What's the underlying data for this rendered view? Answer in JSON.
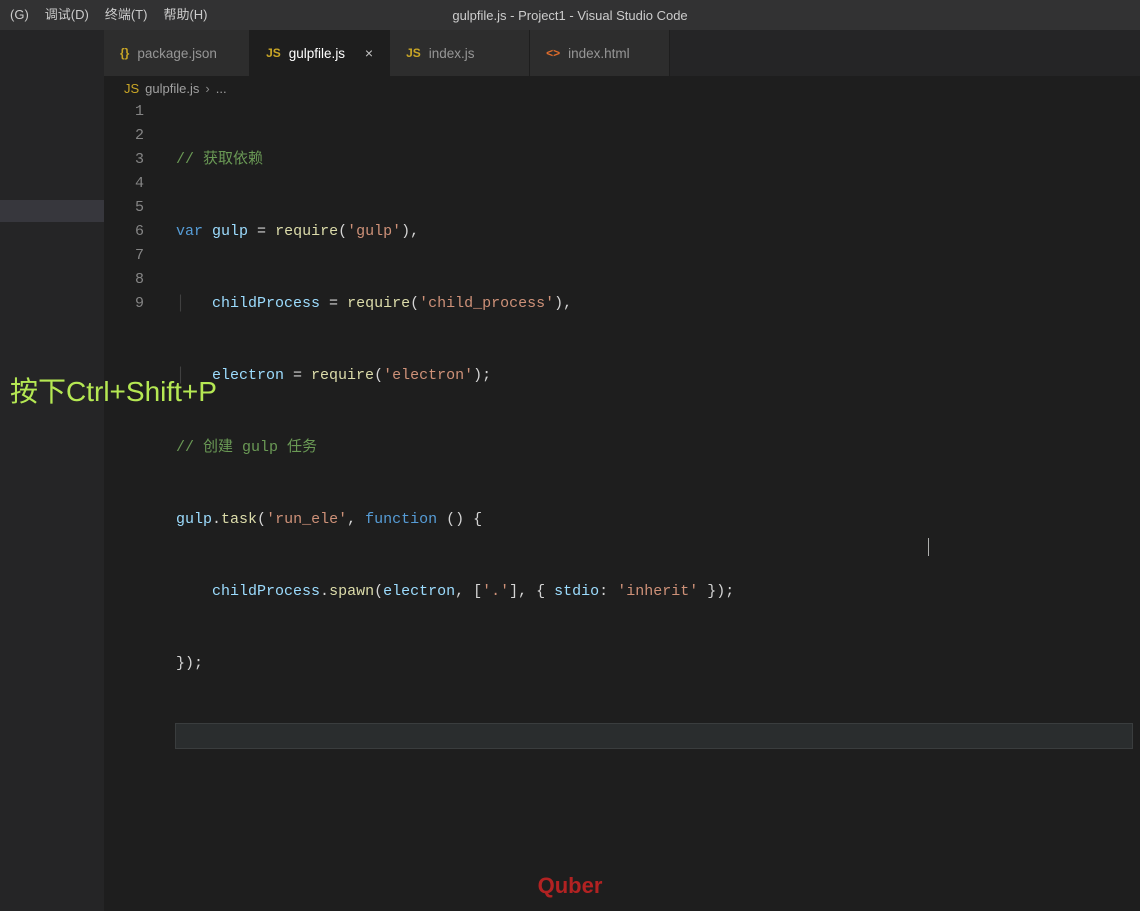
{
  "titlebar": {
    "menus": [
      "(G)",
      "调试(D)",
      "终端(T)",
      "帮助(H)"
    ],
    "title": "gulpfile.js - Project1 - Visual Studio Code"
  },
  "tabs": [
    {
      "icon": "{}",
      "iconClass": "icon-json",
      "label": "package.json",
      "active": false
    },
    {
      "icon": "JS",
      "iconClass": "icon-js",
      "label": "gulpfile.js",
      "active": true
    },
    {
      "icon": "JS",
      "iconClass": "icon-js",
      "label": "index.js",
      "active": false
    },
    {
      "icon": "<>",
      "iconClass": "icon-html",
      "label": "index.html",
      "active": false
    }
  ],
  "breadcrumb": {
    "icon": "JS",
    "file": "gulpfile.js",
    "sep": "›",
    "more": "..."
  },
  "gutter": [
    "1",
    "2",
    "3",
    "4",
    "5",
    "6",
    "7",
    "8",
    "9"
  ],
  "code": {
    "l1_comment": "// 获取依赖",
    "l2_kw": "var",
    "l2_v1": "gulp",
    "l2_eq": " = ",
    "l2_fn": "require",
    "l2_open": "(",
    "l2_str": "'gulp'",
    "l2_close": "),",
    "l3_guide": "│   ",
    "l3_v": "childProcess",
    "l3_eq": " = ",
    "l3_fn": "require",
    "l3_open": "(",
    "l3_str": "'child_process'",
    "l3_close": "),",
    "l4_guide": "│   ",
    "l4_v": "electron",
    "l4_eq": " = ",
    "l4_fn": "require",
    "l4_open": "(",
    "l4_str": "'electron'",
    "l4_close": ");",
    "l5_comment": "// 创建 gulp 任务",
    "l6_obj": "gulp",
    "l6_dot": ".",
    "l6_fn": "task",
    "l6_open": "(",
    "l6_str": "'run_ele'",
    "l6_comma": ", ",
    "l6_kw": "function",
    "l6_paren": " () {",
    "l7_indent": "    ",
    "l7_obj": "childProcess",
    "l7_dot": ".",
    "l7_fn": "spawn",
    "l7_open": "(",
    "l7_arg1": "electron",
    "l7_c1": ", [",
    "l7_str1": "'.'",
    "l7_c2": "], { ",
    "l7_key": "stdio",
    "l7_colon": ": ",
    "l7_str2": "'inherit'",
    "l7_close": " });",
    "l8": "});"
  },
  "annotation": "按下Ctrl+Shift+P",
  "watermark": "Quber"
}
